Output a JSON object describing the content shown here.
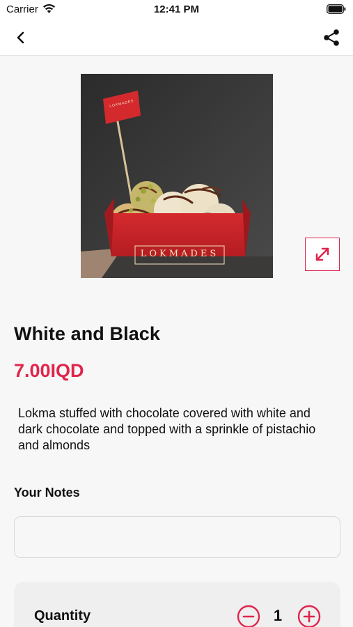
{
  "status_bar": {
    "carrier": "Carrier",
    "time": "12:41 PM"
  },
  "nav": {
    "back_icon": "chevron-left-icon",
    "share_icon": "share-icon"
  },
  "product": {
    "image_brand_text": "LOKMADES",
    "flag_text": "LOKMADES",
    "title": "White and Black",
    "price": "7.00IQD",
    "description": "Lokma stuffed with chocolate covered with white and dark chocolate and topped with a sprinkle of pistachio and almonds",
    "expand_icon": "expand-arrows-icon"
  },
  "notes": {
    "label": "Your Notes",
    "value": "",
    "placeholder": ""
  },
  "quantity": {
    "label": "Quantity",
    "value": "1"
  },
  "colors": {
    "accent": "#e0254c",
    "background": "#f7f7f7",
    "card": "#efefef"
  }
}
